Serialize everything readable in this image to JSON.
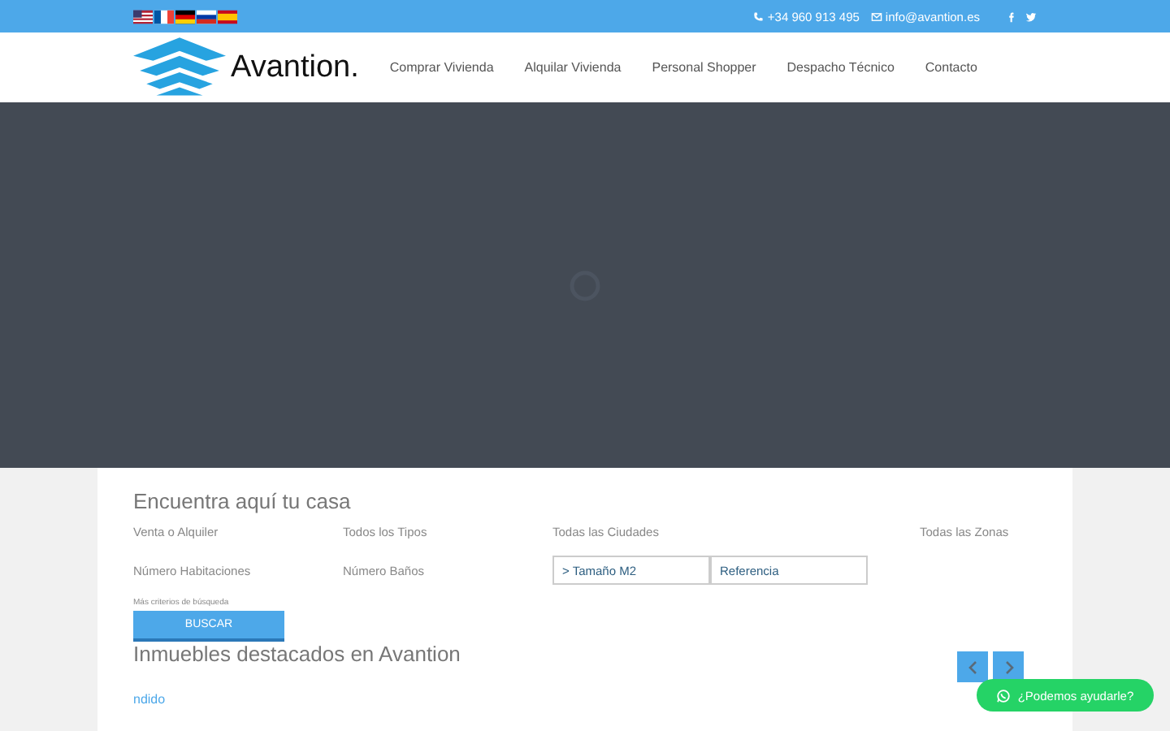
{
  "top_bar": {
    "languages": [
      {
        "kind": "us"
      },
      {
        "kind": "fr"
      },
      {
        "kind": "de"
      },
      {
        "kind": "ru"
      },
      {
        "kind": "es"
      }
    ],
    "phone": "+34 960 913 495",
    "email": "info@avantion.es"
  },
  "header": {
    "logo_text": "Avantion.",
    "nav": [
      {
        "label": "Comprar Vivienda"
      },
      {
        "label": "Alquilar Vivienda"
      },
      {
        "label": "Personal Shopper"
      },
      {
        "label": "Despacho Técnico"
      },
      {
        "label": "Contacto"
      }
    ]
  },
  "search": {
    "title": "Encuentra aquí tu casa",
    "fields": [
      {
        "kind": "select",
        "label": "Venta o Alquiler"
      },
      {
        "kind": "select",
        "label": "Todos los Tipos"
      },
      {
        "kind": "select",
        "label": "Todas las Ciudades"
      },
      {
        "kind": "select",
        "label": "Todas las Zonas"
      },
      {
        "kind": "select",
        "label": "Número Habitaciones"
      },
      {
        "kind": "select",
        "label": "Número Baños"
      },
      {
        "kind": "input",
        "label": "> Tamaño M2"
      },
      {
        "kind": "input",
        "label": "Referencia"
      }
    ],
    "more_link": "Más criterios de búsqueda",
    "button": "BUSCAR"
  },
  "featured": {
    "title": "Inmuebles destacados en Avantion",
    "subtitle": "ndido"
  },
  "whatsapp": {
    "label": "¿Podemos ayudarle?"
  }
}
